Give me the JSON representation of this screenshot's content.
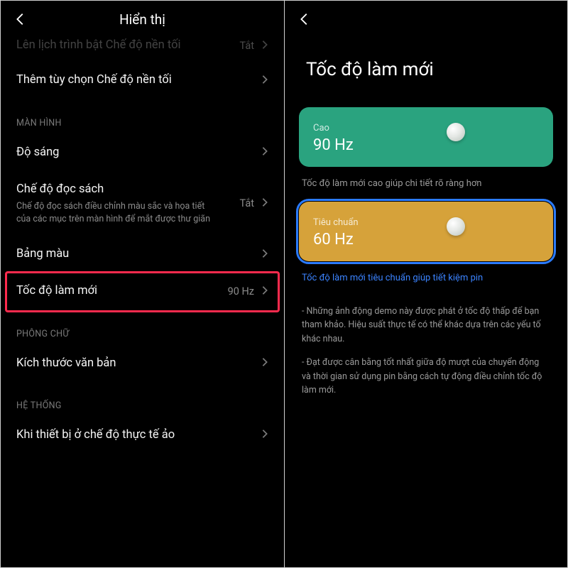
{
  "left": {
    "header_title": "Hiển thị",
    "row_schedule": {
      "title": "Lên lịch trình bật Chế độ nền tối",
      "value": "Tắt"
    },
    "row_more_dark": {
      "title": "Thêm tùy chọn Chế độ nền tối"
    },
    "section_screen": "MÀN HÌNH",
    "row_brightness": {
      "title": "Độ sáng"
    },
    "row_reading": {
      "title": "Chế độ đọc sách",
      "sub": "Chế độ đọc sách điều chỉnh màu sắc và họa tiết của các mục trên màn hình để mắt được thư giãn",
      "value": "Tắt"
    },
    "row_palette": {
      "title": "Bảng màu"
    },
    "row_refresh": {
      "title": "Tốc độ làm mới",
      "value": "90 Hz"
    },
    "section_font": "PHÔNG CHỮ",
    "row_textsize": {
      "title": "Kích thước văn bản"
    },
    "section_system": "HỆ THỐNG",
    "row_vr": {
      "title": "Khi thiết bị ở chế độ thực tế ảo"
    }
  },
  "right": {
    "page_title": "Tốc độ làm mới",
    "option_high": {
      "label": "Cao",
      "hz": "90 Hz"
    },
    "caption_high": "Tốc độ làm mới cao giúp chi tiết rõ ràng hơn",
    "option_std": {
      "label": "Tiêu chuẩn",
      "hz": "60 Hz"
    },
    "caption_std": "Tốc độ làm mới tiêu chuẩn giúp tiết kiệm pin",
    "note1": "- Những ảnh động demo này được phát ở tốc độ thấp để bạn tham khảo. Hiệu suất thực tế có thể khác dựa trên các yếu tố khác nhau.",
    "note2": "- Đạt được cân bằng tốt nhất giữa độ mượt của chuyển động và thời gian sử dụng pin bằng cách tự động điều chỉnh tốc độ làm mới."
  }
}
